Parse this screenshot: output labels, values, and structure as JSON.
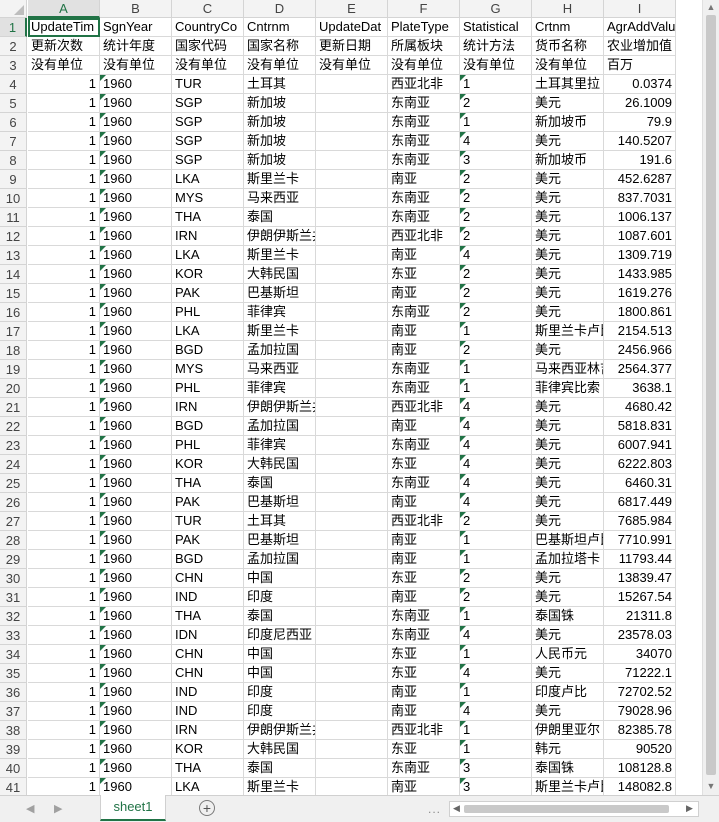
{
  "sheet": {
    "columns": [
      "A",
      "B",
      "C",
      "D",
      "E",
      "F",
      "G",
      "H",
      "I"
    ],
    "selected_column": "A",
    "selected_row": 1,
    "rows": [
      {
        "n": 1,
        "cells": [
          "UpdateTim",
          "SgnYear",
          "CountryCo",
          "Cntrnm",
          "UpdateDat",
          "PlateType",
          "Statistical",
          "Crtnm",
          "AgrAddValue"
        ]
      },
      {
        "n": 2,
        "cells": [
          "更新次数",
          "统计年度",
          "国家代码",
          "国家名称",
          "更新日期",
          "所属板块",
          "统计方法",
          "货币名称",
          "农业增加值"
        ]
      },
      {
        "n": 3,
        "cells": [
          "没有单位",
          "没有单位",
          "没有单位",
          "没有单位",
          "没有单位",
          "没有单位",
          "没有单位",
          "没有单位",
          "百万"
        ]
      },
      {
        "n": 4,
        "cells": [
          "1",
          "1960",
          "TUR",
          "土耳其",
          "",
          "西亚北非",
          "1",
          "土耳其里拉",
          "0.0374"
        ]
      },
      {
        "n": 5,
        "cells": [
          "1",
          "1960",
          "SGP",
          "新加坡",
          "",
          "东南亚",
          "2",
          "美元",
          "26.1009"
        ]
      },
      {
        "n": 6,
        "cells": [
          "1",
          "1960",
          "SGP",
          "新加坡",
          "",
          "东南亚",
          "1",
          "新加坡币",
          "79.9"
        ]
      },
      {
        "n": 7,
        "cells": [
          "1",
          "1960",
          "SGP",
          "新加坡",
          "",
          "东南亚",
          "4",
          "美元",
          "140.5207"
        ]
      },
      {
        "n": 8,
        "cells": [
          "1",
          "1960",
          "SGP",
          "新加坡",
          "",
          "东南亚",
          "3",
          "新加坡币",
          "191.6"
        ]
      },
      {
        "n": 9,
        "cells": [
          "1",
          "1960",
          "LKA",
          "斯里兰卡",
          "",
          "南亚",
          "2",
          "美元",
          "452.6287"
        ]
      },
      {
        "n": 10,
        "cells": [
          "1",
          "1960",
          "MYS",
          "马来西亚",
          "",
          "东南亚",
          "2",
          "美元",
          "837.7031"
        ]
      },
      {
        "n": 11,
        "cells": [
          "1",
          "1960",
          "THA",
          "泰国",
          "",
          "东南亚",
          "2",
          "美元",
          "1006.137"
        ]
      },
      {
        "n": 12,
        "cells": [
          "1",
          "1960",
          "IRN",
          "伊朗伊斯兰共和国",
          "",
          "西亚北非",
          "2",
          "美元",
          "1087.601"
        ]
      },
      {
        "n": 13,
        "cells": [
          "1",
          "1960",
          "LKA",
          "斯里兰卡",
          "",
          "南亚",
          "4",
          "美元",
          "1309.719"
        ]
      },
      {
        "n": 14,
        "cells": [
          "1",
          "1960",
          "KOR",
          "大韩民国",
          "",
          "东亚",
          "2",
          "美元",
          "1433.985"
        ]
      },
      {
        "n": 15,
        "cells": [
          "1",
          "1960",
          "PAK",
          "巴基斯坦",
          "",
          "南亚",
          "2",
          "美元",
          "1619.276"
        ]
      },
      {
        "n": 16,
        "cells": [
          "1",
          "1960",
          "PHL",
          "菲律宾",
          "",
          "东南亚",
          "2",
          "美元",
          "1800.861"
        ]
      },
      {
        "n": 17,
        "cells": [
          "1",
          "1960",
          "LKA",
          "斯里兰卡",
          "",
          "南亚",
          "1",
          "斯里兰卡卢比",
          "2154.513"
        ]
      },
      {
        "n": 18,
        "cells": [
          "1",
          "1960",
          "BGD",
          "孟加拉国",
          "",
          "南亚",
          "2",
          "美元",
          "2456.966"
        ]
      },
      {
        "n": 19,
        "cells": [
          "1",
          "1960",
          "MYS",
          "马来西亚",
          "",
          "东南亚",
          "1",
          "马来西亚林吉特",
          "2564.377"
        ]
      },
      {
        "n": 20,
        "cells": [
          "1",
          "1960",
          "PHL",
          "菲律宾",
          "",
          "东南亚",
          "1",
          "菲律宾比索",
          "3638.1"
        ]
      },
      {
        "n": 21,
        "cells": [
          "1",
          "1960",
          "IRN",
          "伊朗伊斯兰共和国",
          "",
          "西亚北非",
          "4",
          "美元",
          "4680.42"
        ]
      },
      {
        "n": 22,
        "cells": [
          "1",
          "1960",
          "BGD",
          "孟加拉国",
          "",
          "南亚",
          "4",
          "美元",
          "5818.831"
        ]
      },
      {
        "n": 23,
        "cells": [
          "1",
          "1960",
          "PHL",
          "菲律宾",
          "",
          "东南亚",
          "4",
          "美元",
          "6007.941"
        ]
      },
      {
        "n": 24,
        "cells": [
          "1",
          "1960",
          "KOR",
          "大韩民国",
          "",
          "东亚",
          "4",
          "美元",
          "6222.803"
        ]
      },
      {
        "n": 25,
        "cells": [
          "1",
          "1960",
          "THA",
          "泰国",
          "",
          "东南亚",
          "4",
          "美元",
          "6460.31"
        ]
      },
      {
        "n": 26,
        "cells": [
          "1",
          "1960",
          "PAK",
          "巴基斯坦",
          "",
          "南亚",
          "4",
          "美元",
          "6817.449"
        ]
      },
      {
        "n": 27,
        "cells": [
          "1",
          "1960",
          "TUR",
          "土耳其",
          "",
          "西亚北非",
          "2",
          "美元",
          "7685.984"
        ]
      },
      {
        "n": 28,
        "cells": [
          "1",
          "1960",
          "PAK",
          "巴基斯坦",
          "",
          "南亚",
          "1",
          "巴基斯坦卢比",
          "7710.991"
        ]
      },
      {
        "n": 29,
        "cells": [
          "1",
          "1960",
          "BGD",
          "孟加拉国",
          "",
          "南亚",
          "1",
          "孟加拉塔卡",
          "11793.44"
        ]
      },
      {
        "n": 30,
        "cells": [
          "1",
          "1960",
          "CHN",
          "中国",
          "",
          "东亚",
          "2",
          "美元",
          "13839.47"
        ]
      },
      {
        "n": 31,
        "cells": [
          "1",
          "1960",
          "IND",
          "印度",
          "",
          "南亚",
          "2",
          "美元",
          "15267.54"
        ]
      },
      {
        "n": 32,
        "cells": [
          "1",
          "1960",
          "THA",
          "泰国",
          "",
          "东南亚",
          "1",
          "泰国铢",
          "21311.8"
        ]
      },
      {
        "n": 33,
        "cells": [
          "1",
          "1960",
          "IDN",
          "印度尼西亚",
          "",
          "东南亚",
          "4",
          "美元",
          "23578.03"
        ]
      },
      {
        "n": 34,
        "cells": [
          "1",
          "1960",
          "CHN",
          "中国",
          "",
          "东亚",
          "1",
          "人民币元",
          "34070"
        ]
      },
      {
        "n": 35,
        "cells": [
          "1",
          "1960",
          "CHN",
          "中国",
          "",
          "东亚",
          "4",
          "美元",
          "71222.1"
        ]
      },
      {
        "n": 36,
        "cells": [
          "1",
          "1960",
          "IND",
          "印度",
          "",
          "南亚",
          "1",
          "印度卢比",
          "72702.52"
        ]
      },
      {
        "n": 37,
        "cells": [
          "1",
          "1960",
          "IND",
          "印度",
          "",
          "南亚",
          "4",
          "美元",
          "79028.96"
        ]
      },
      {
        "n": 38,
        "cells": [
          "1",
          "1960",
          "IRN",
          "伊朗伊斯兰共和国",
          "",
          "西亚北非",
          "1",
          "伊朗里亚尔",
          "82385.78"
        ]
      },
      {
        "n": 39,
        "cells": [
          "1",
          "1960",
          "KOR",
          "大韩民国",
          "",
          "东亚",
          "1",
          "韩元",
          "90520"
        ]
      },
      {
        "n": 40,
        "cells": [
          "1",
          "1960",
          "THA",
          "泰国",
          "",
          "东南亚",
          "3",
          "泰国铢",
          "108128.8"
        ]
      },
      {
        "n": 41,
        "cells": [
          "1",
          "1960",
          "LKA",
          "斯里兰卡",
          "",
          "南亚",
          "3",
          "斯里兰卡卢比",
          "148082.8"
        ]
      }
    ]
  },
  "sheet_tabs": [
    {
      "label": "sheet1",
      "active": true
    }
  ],
  "bottom_bar": {
    "add_sheet_label": "+",
    "overflow_label": "..."
  },
  "accent_color": "#217346",
  "flag_color": "#217346"
}
